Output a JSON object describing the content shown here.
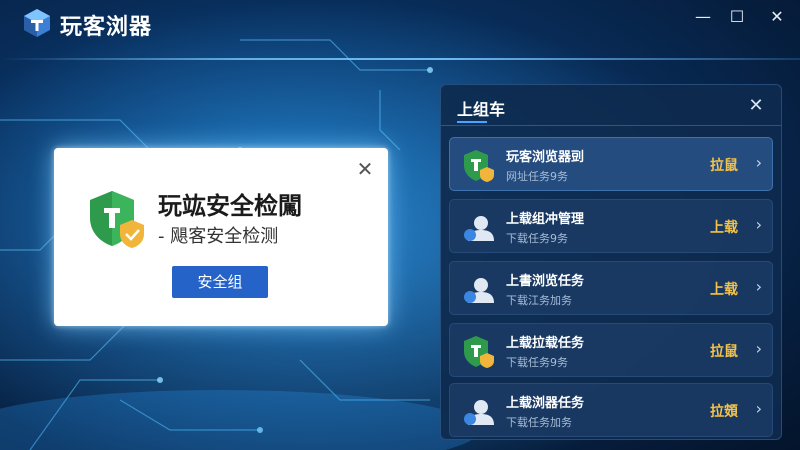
{
  "app": {
    "title": "玩客浏器"
  },
  "window_controls": {
    "minimize": "—",
    "maximize": "☐",
    "close": "✕"
  },
  "popup": {
    "title": "玩竑安全检闖",
    "subtitle": "- 飓客安全检测",
    "button_label": "安全组",
    "close": "✕"
  },
  "panel": {
    "title": "上组车",
    "close": "✕",
    "items": [
      {
        "name": "玩客浏览器剅",
        "desc": "网址任务9务",
        "action": "拉鼠",
        "icon": "shield-icon",
        "active": true
      },
      {
        "name": "上载组冲管理",
        "desc": "下载任务9务",
        "action": "上载",
        "icon": "user-icon",
        "active": false
      },
      {
        "name": "上書浏览任务",
        "desc": "下载江务加务",
        "action": "上载",
        "icon": "user-icon",
        "active": false
      },
      {
        "name": "上载拉载任务",
        "desc": "下载任务9务",
        "action": "拉鼠",
        "icon": "shield-icon",
        "active": false
      },
      {
        "name": "上载浏器任务",
        "desc": "下载任务加务",
        "action": "拉頞",
        "icon": "user-icon",
        "active": false
      }
    ],
    "chevron": "›"
  },
  "colors": {
    "accent": "#4aa3ff",
    "action_gold": "#f3c24a",
    "button_blue": "#2563c9",
    "shield_green": "#2e9a4c",
    "shield_gold": "#f0b53a"
  }
}
